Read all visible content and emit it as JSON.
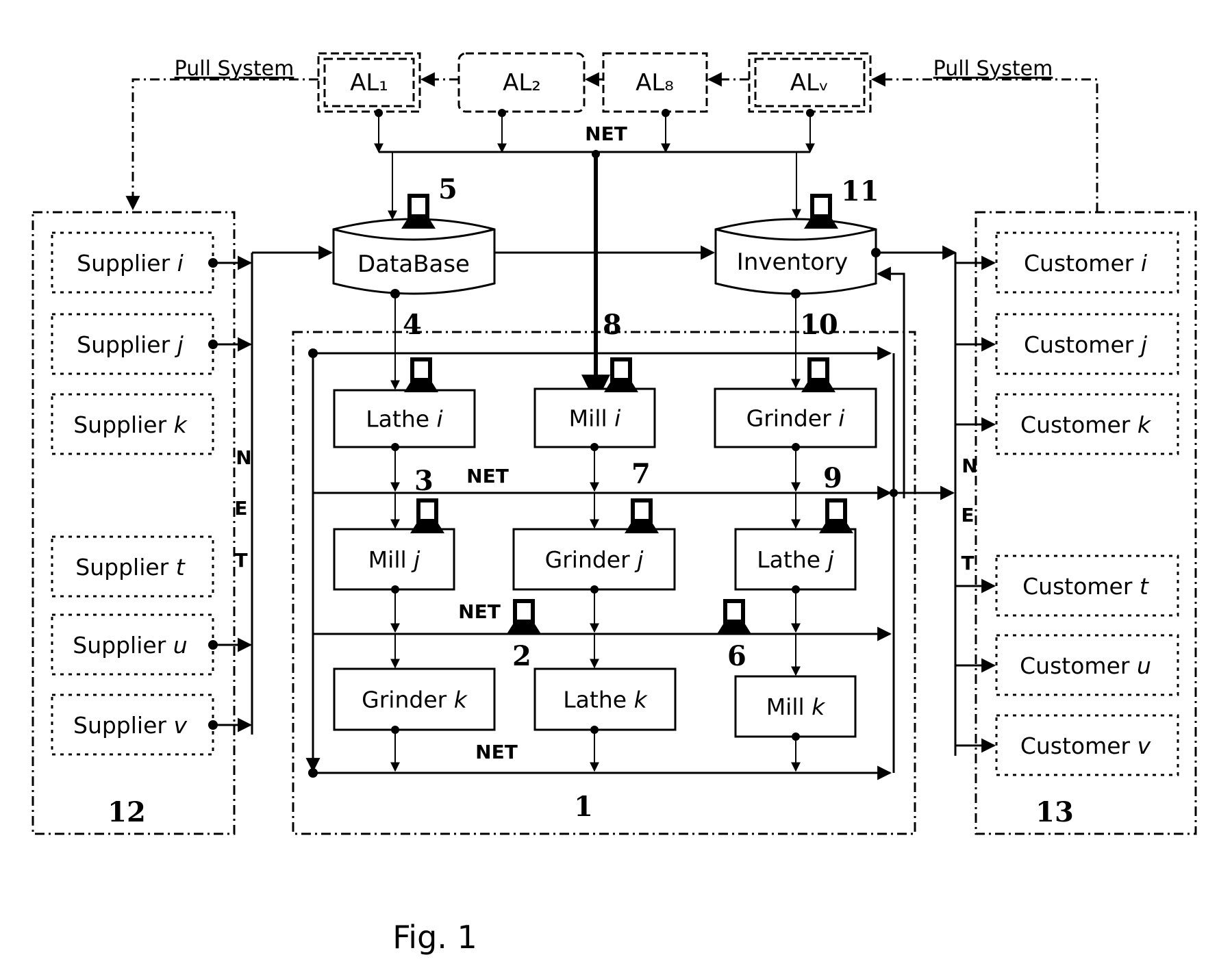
{
  "figure": {
    "caption": "Fig. 1"
  },
  "pull_system": {
    "left_label": "Pull System",
    "right_label": "Pull System"
  },
  "assembly_lines": [
    {
      "id": "al1",
      "label": "AL₁"
    },
    {
      "id": "al2",
      "label": "AL₂"
    },
    {
      "id": "al8",
      "label": "AL₈"
    },
    {
      "id": "alv",
      "label": "ALᵥ"
    }
  ],
  "net_labels": {
    "top": "NET",
    "row1": "NET",
    "row2": "NET",
    "row3": "NET",
    "supplier_bus": [
      "N",
      "E",
      "T"
    ],
    "customer_bus": [
      "N",
      "E",
      "T"
    ]
  },
  "storage": {
    "database": "DataBase",
    "inventory": "Inventory"
  },
  "suppliers": {
    "group_number": "12",
    "items": [
      {
        "name": "Supplier",
        "index": "i"
      },
      {
        "name": "Supplier",
        "index": "j"
      },
      {
        "name": "Supplier",
        "index": "k"
      },
      {
        "name": "Supplier",
        "index": "t"
      },
      {
        "name": "Supplier",
        "index": "u"
      },
      {
        "name": "Supplier",
        "index": "v"
      }
    ]
  },
  "customers": {
    "group_number": "13",
    "items": [
      {
        "name": "Customer",
        "index": "i"
      },
      {
        "name": "Customer",
        "index": "j"
      },
      {
        "name": "Customer",
        "index": "k"
      },
      {
        "name": "Customer",
        "index": "t"
      },
      {
        "name": "Customer",
        "index": "u"
      },
      {
        "name": "Customer",
        "index": "v"
      }
    ]
  },
  "factory": {
    "group_number": "1",
    "machines": [
      {
        "name": "Lathe",
        "index": "i"
      },
      {
        "name": "Mill",
        "index": "i"
      },
      {
        "name": "Grinder",
        "index": "i"
      },
      {
        "name": "Mill",
        "index": "j"
      },
      {
        "name": "Grinder",
        "index": "j"
      },
      {
        "name": "Lathe",
        "index": "j"
      },
      {
        "name": "Grinder",
        "index": "k"
      },
      {
        "name": "Lathe",
        "index": "k"
      },
      {
        "name": "Mill",
        "index": "k"
      }
    ]
  },
  "computer_numbers": {
    "c2": "2",
    "c3": "3",
    "c4": "4",
    "c5": "5",
    "c6": "6",
    "c7": "7",
    "c8": "8",
    "c9": "9",
    "c10": "10",
    "c11": "11"
  }
}
